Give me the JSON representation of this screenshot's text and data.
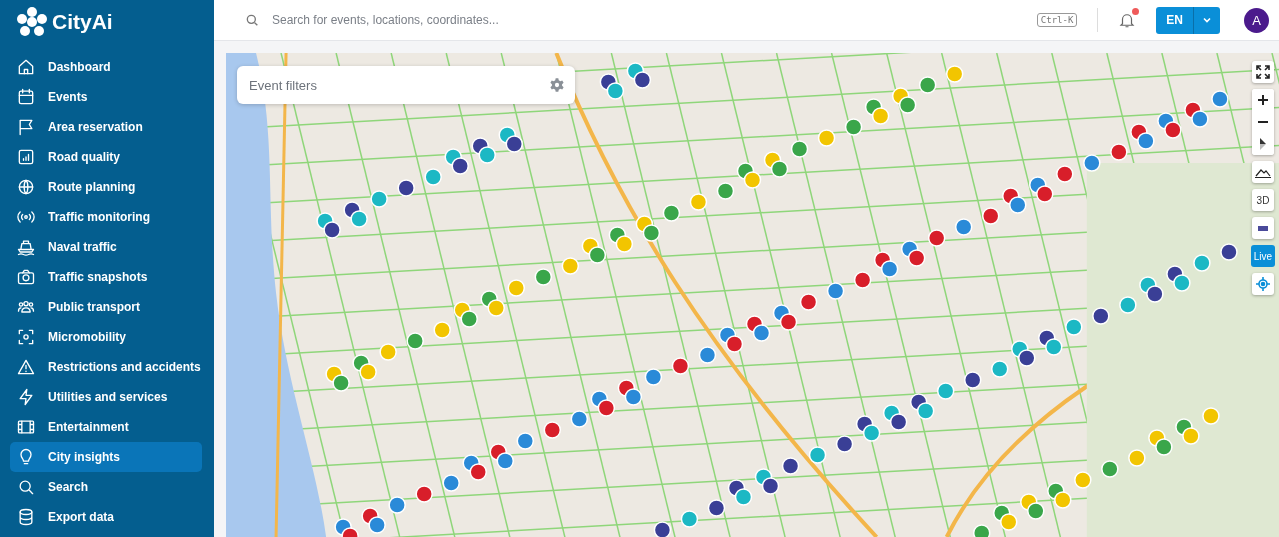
{
  "brand": {
    "name": "CityAi"
  },
  "sidebar": {
    "items": [
      {
        "label": "Dashboard",
        "selected": false
      },
      {
        "label": "Events",
        "selected": false
      },
      {
        "label": "Area reservation",
        "selected": false
      },
      {
        "label": "Road quality",
        "selected": false
      },
      {
        "label": "Route planning",
        "selected": false
      },
      {
        "label": "Traffic monitoring",
        "selected": false
      },
      {
        "label": "Naval traffic",
        "selected": false
      },
      {
        "label": "Traffic snapshots",
        "selected": false
      },
      {
        "label": "Public transport",
        "selected": false
      },
      {
        "label": "Micromobility",
        "selected": false
      },
      {
        "label": "Restrictions and accidents",
        "selected": false
      },
      {
        "label": "Utilities and services",
        "selected": false
      },
      {
        "label": "Entertainment",
        "selected": false
      },
      {
        "label": "City insights",
        "selected": true
      },
      {
        "label": "Search",
        "selected": false
      },
      {
        "label": "Export data",
        "selected": false
      }
    ]
  },
  "topbar": {
    "search": {
      "placeholder": "Search for events, locations, coordinates..."
    },
    "shortcut": "Ctrl-K",
    "notifications": {
      "unread": true
    },
    "language": "EN",
    "avatar": "A"
  },
  "map": {
    "event_filters": {
      "placeholder": "Event filters"
    },
    "controls": {
      "three_d": "3D",
      "live": "Live"
    }
  }
}
